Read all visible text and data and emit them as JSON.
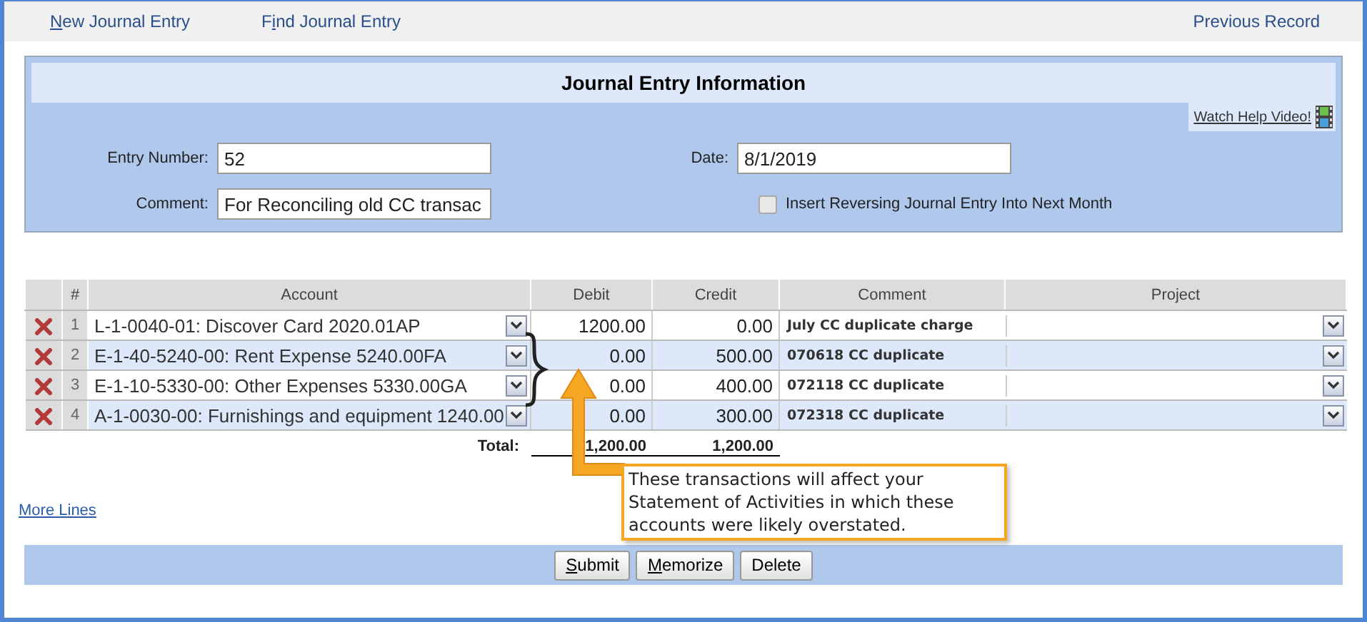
{
  "nav": {
    "links": [
      {
        "key": "N",
        "after": "ew Journal Entry"
      },
      {
        "before": "F",
        "key": "i",
        "after": "nd Journal Entry"
      }
    ],
    "previous": "Previous Record"
  },
  "panel": {
    "title": "Journal Entry Information",
    "help_link": "Watch Help Video!",
    "entry_number": {
      "label": "Entry Number:",
      "value": "52"
    },
    "comment": {
      "label": "Comment:",
      "value": "For Reconciling old CC transac"
    },
    "date": {
      "label": "Date:",
      "value": "8/1/2019"
    },
    "reversing": {
      "label": "Insert Reversing Journal Entry Into Next Month",
      "checked": false
    }
  },
  "table": {
    "columns": [
      "#",
      "Account",
      "Debit",
      "Credit",
      "Comment",
      "Project"
    ],
    "rows": [
      {
        "number": "1",
        "account": "L-1-0040-01: Discover Card 2020.01AP",
        "debit": "1200.00",
        "credit": "0.00",
        "comment": "July CC duplicate charge"
      },
      {
        "number": "2",
        "account": "E-1-40-5240-00: Rent Expense 5240.00FA",
        "debit": "0.00",
        "credit": "500.00",
        "comment": "070618 CC duplicate"
      },
      {
        "number": "3",
        "account": "E-1-10-5330-00: Other Expenses 5330.00GA",
        "debit": "0.00",
        "credit": "400.00",
        "comment": "072118 CC duplicate"
      },
      {
        "number": "4",
        "account": "A-1-0030-00: Furnishings and equipment 1240.00",
        "debit": "0.00",
        "credit": "300.00",
        "comment": "072318 CC duplicate"
      }
    ],
    "total_label": "Total:",
    "total_debit": "1,200.00",
    "total_credit": "1,200.00"
  },
  "more_lines": {
    "before": "More ",
    "key": "L",
    "after": "ines"
  },
  "callout": "These transactions will affect your Statement of Activities in which these accounts were likely overstated.",
  "buttons": [
    {
      "key": "S",
      "after": "ubmit"
    },
    {
      "key": "M",
      "after": "emorize"
    },
    {
      "before": "Delete"
    }
  ]
}
